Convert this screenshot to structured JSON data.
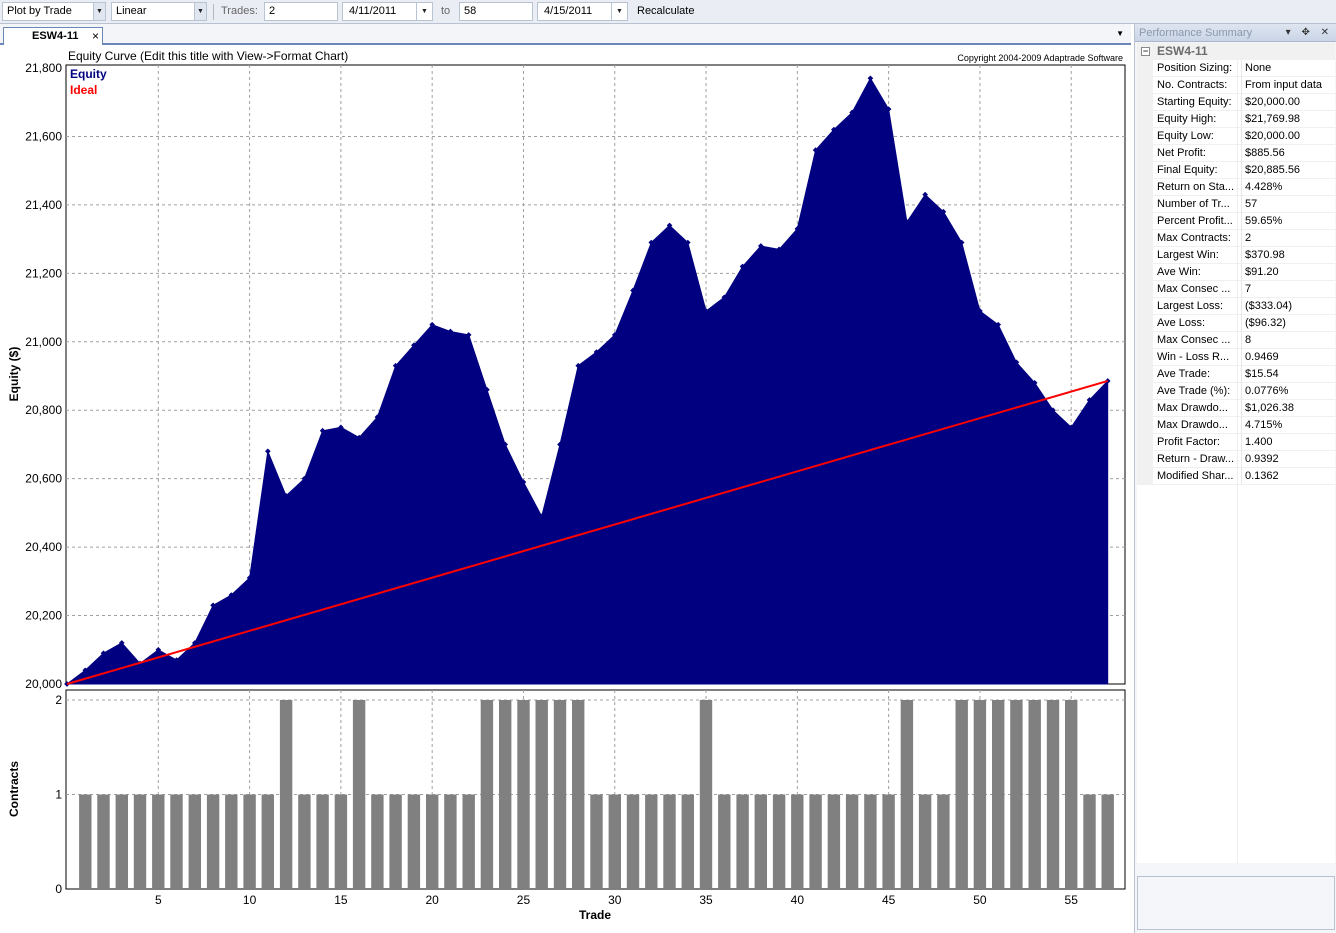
{
  "toolbar": {
    "plot_mode": "Plot by Trade",
    "scale": "Linear",
    "trades_label": "Trades:",
    "trades_from": "2",
    "date_from": "4/11/2011",
    "to_label": "to",
    "trades_to": "58",
    "date_to": "4/15/2011",
    "recalculate_label": "Recalculate"
  },
  "tab": {
    "label": "ESW4-11",
    "close": "×",
    "menu": "▼"
  },
  "chart_data": {
    "type": "area",
    "title": "Equity Curve (Edit this title with View->Format Chart)",
    "copyright": "Copyright 2004-2009 Adaptrade Software",
    "xlabel": "Trade",
    "ylabel": "Equity ($)",
    "ylabel2": "Contracts",
    "ylim": [
      20000,
      21800
    ],
    "yticks": [
      "20,000",
      "20,200",
      "20,400",
      "20,600",
      "20,800",
      "21,000",
      "21,200",
      "21,400",
      "21,600",
      "21,800"
    ],
    "xticks": [
      "5",
      "10",
      "15",
      "20",
      "25",
      "30",
      "35",
      "40",
      "45",
      "50",
      "55"
    ],
    "contract_ticks": [
      "0",
      "1",
      "2"
    ],
    "legend": [
      "Equity",
      "Ideal"
    ],
    "colors": {
      "equity": "#000080",
      "ideal": "#ff0000",
      "contracts": "#808080"
    },
    "equity": [
      20000,
      20040,
      20090,
      20120,
      20060,
      20100,
      20070,
      20120,
      20230,
      20260,
      20310,
      20680,
      20550,
      20600,
      20740,
      20750,
      20720,
      20780,
      20930,
      20990,
      21050,
      21030,
      21020,
      20860,
      20700,
      20590,
      20490,
      20700,
      20930,
      20970,
      21020,
      21150,
      21290,
      21340,
      21290,
      21090,
      21130,
      21220,
      21280,
      21270,
      21330,
      21560,
      21620,
      21670,
      21770,
      21680,
      21350,
      21430,
      21380,
      21290,
      21090,
      21050,
      20940,
      20880,
      20800,
      20750,
      20830,
      20885.56
    ],
    "ideal": [
      20000,
      20885.56
    ],
    "contracts": [
      1,
      1,
      1,
      1,
      1,
      1,
      1,
      1,
      1,
      1,
      1,
      2,
      1,
      1,
      1,
      2,
      1,
      1,
      1,
      1,
      1,
      1,
      2,
      2,
      2,
      2,
      2,
      2,
      1,
      1,
      1,
      1,
      1,
      1,
      2,
      1,
      1,
      1,
      1,
      1,
      1,
      1,
      1,
      1,
      1,
      2,
      1,
      1,
      2,
      2,
      2,
      2,
      2,
      2,
      2,
      1,
      1
    ]
  },
  "summary": {
    "panel_title": "Performance Summary",
    "panel_icons": "▾ ✥ ✕",
    "group": "ESW4-11",
    "collapse": "−",
    "rows": [
      {
        "key": "Position Sizing:",
        "value": "None"
      },
      {
        "key": "No. Contracts:",
        "value": "From input data"
      },
      {
        "key": "Starting Equity:",
        "value": "$20,000.00"
      },
      {
        "key": "Equity High:",
        "value": "$21,769.98"
      },
      {
        "key": "Equity Low:",
        "value": "$20,000.00"
      },
      {
        "key": "Net Profit:",
        "value": "$885.56"
      },
      {
        "key": "Final Equity:",
        "value": "$20,885.56"
      },
      {
        "key": "Return on Sta...",
        "value": "4.428%"
      },
      {
        "key": "Number of Tr...",
        "value": "57"
      },
      {
        "key": "Percent Profit...",
        "value": "59.65%"
      },
      {
        "key": "Max Contracts:",
        "value": "2"
      },
      {
        "key": "Largest Win:",
        "value": "$370.98"
      },
      {
        "key": "Ave Win:",
        "value": "$91.20"
      },
      {
        "key": "Max Consec ...",
        "value": "7"
      },
      {
        "key": "Largest Loss:",
        "value": "($333.04)"
      },
      {
        "key": "Ave Loss:",
        "value": "($96.32)"
      },
      {
        "key": "Max Consec ...",
        "value": "8"
      },
      {
        "key": "Win - Loss R...",
        "value": "0.9469"
      },
      {
        "key": "Ave Trade:",
        "value": "$15.54"
      },
      {
        "key": "Ave Trade (%):",
        "value": "0.0776%"
      },
      {
        "key": "Max Drawdo...",
        "value": "$1,026.38"
      },
      {
        "key": "Max Drawdo...",
        "value": "4.715%"
      },
      {
        "key": "Profit Factor:",
        "value": "1.400"
      },
      {
        "key": "Return - Draw...",
        "value": "0.9392"
      },
      {
        "key": "Modified Shar...",
        "value": "0.1362"
      }
    ]
  }
}
